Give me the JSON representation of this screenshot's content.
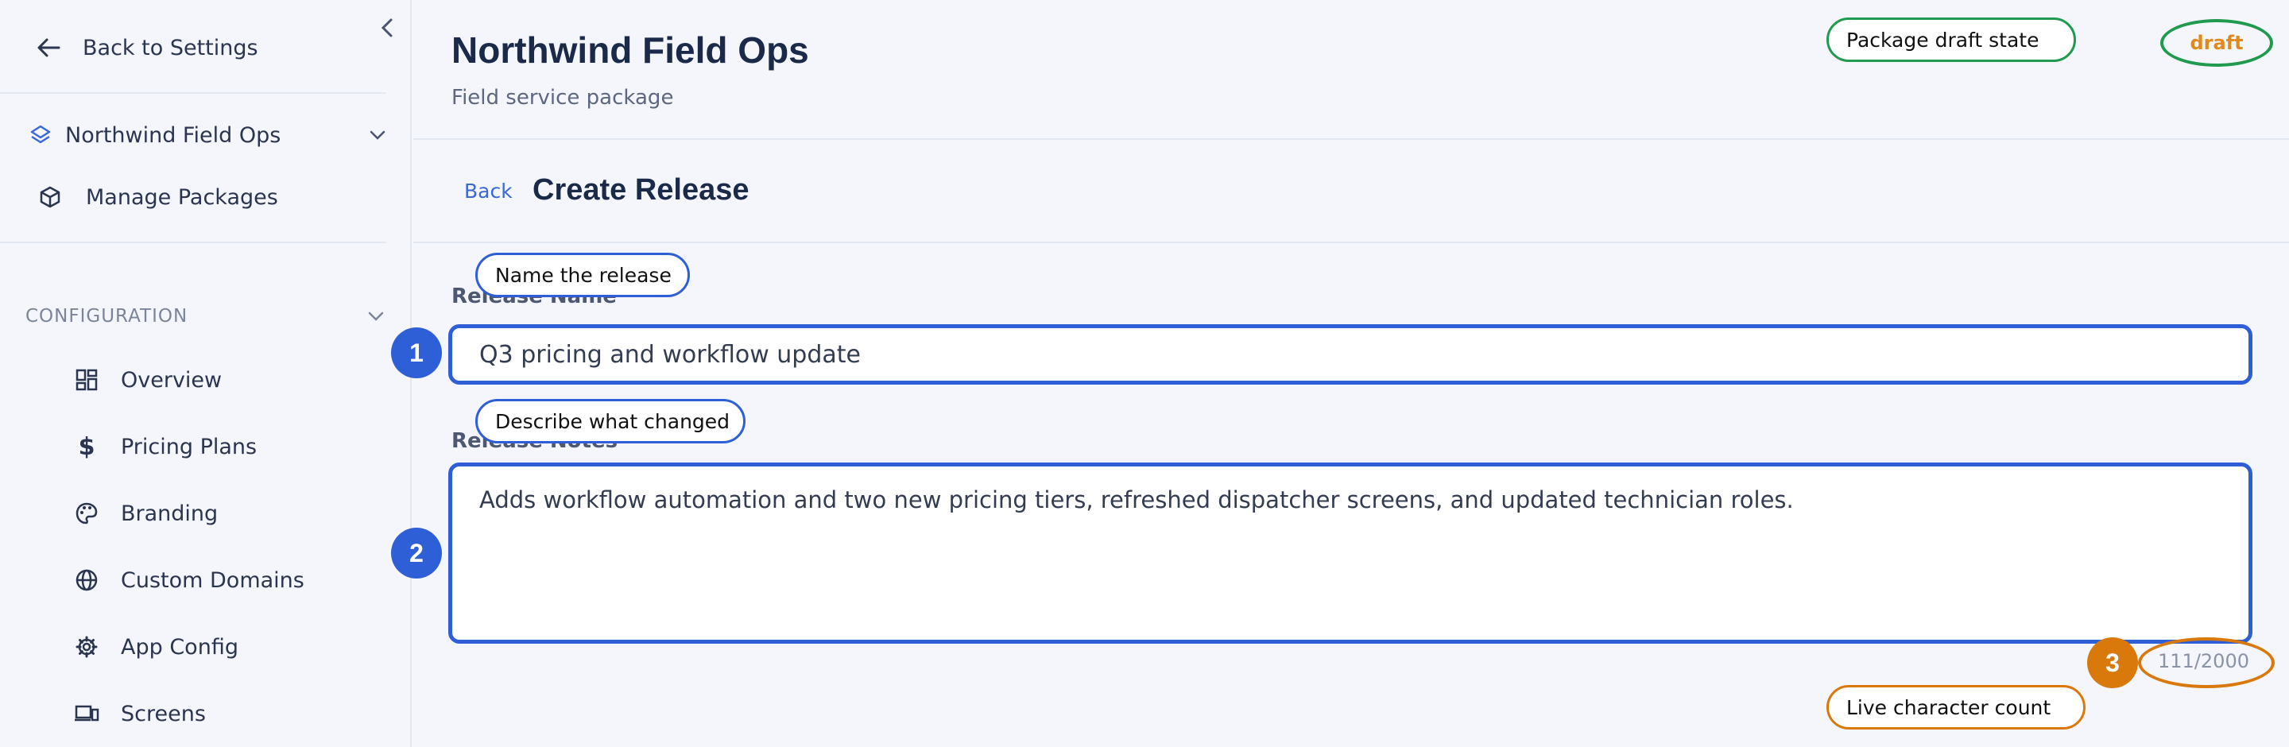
{
  "sidebar": {
    "back_label": "Back to Settings",
    "org_name": "Northwind Field Ops",
    "manage_label": "Manage Packages",
    "section_label": "CONFIGURATION",
    "items": [
      {
        "label": "Overview",
        "icon": "dashboard-icon"
      },
      {
        "label": "Pricing Plans",
        "icon": "dollar-icon"
      },
      {
        "label": "Branding",
        "icon": "palette-icon"
      },
      {
        "label": "Custom Domains",
        "icon": "globe-icon"
      },
      {
        "label": "App Config",
        "icon": "gear-icon"
      },
      {
        "label": "Screens",
        "icon": "devices-icon"
      }
    ]
  },
  "header": {
    "title": "Northwind Field Ops",
    "subtitle": "Field service package",
    "status": "draft"
  },
  "page": {
    "back_label": "Back",
    "heading": "Create Release"
  },
  "form": {
    "name_label": "Release Name",
    "name_value": "Q3 pricing and workflow update",
    "notes_label": "Release Notes",
    "notes_value": "Adds workflow automation and two new pricing tiers, refreshed dispatcher screens, and updated technician roles.",
    "char_count": "111/2000"
  },
  "annotations": {
    "status_callout": "Package draft state",
    "name_callout": "Name the release",
    "notes_callout": "Describe what changed",
    "count_callout": "Live character count",
    "step1": "1",
    "step2": "2",
    "step3": "3"
  },
  "colors": {
    "accent": "#2f5fd6",
    "draft_text": "#e08a1e",
    "annotation_green": "#1f9a4e",
    "annotation_orange": "#d9790c"
  }
}
